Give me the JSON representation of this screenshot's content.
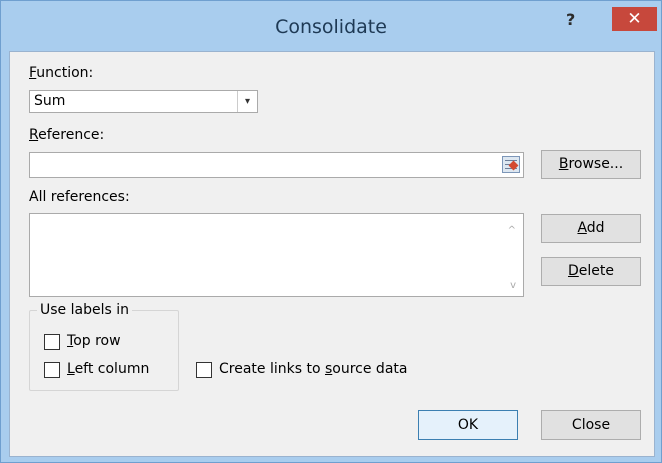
{
  "dialog": {
    "title": "Consolidate",
    "help_glyph": "?",
    "close_glyph": "✕"
  },
  "function": {
    "label_access": "F",
    "label_rest": "unction:",
    "selected": "Sum",
    "arrow_glyph": "▾"
  },
  "reference": {
    "label_access": "R",
    "label_rest": "eference:",
    "value": ""
  },
  "browse": {
    "access": "B",
    "rest": "rowse..."
  },
  "all_references": {
    "label": "All references:",
    "scroll_up": "^",
    "scroll_down": "v"
  },
  "add": {
    "access": "A",
    "rest": "dd"
  },
  "delete": {
    "access": "D",
    "rest": "elete"
  },
  "labels_group": {
    "legend": "Use labels in",
    "top_row": {
      "access": "T",
      "rest": "op row",
      "checked": false
    },
    "left_column": {
      "access": "L",
      "rest": "eft column",
      "checked": false
    }
  },
  "links": {
    "before": "Create links to ",
    "access": "s",
    "after": "ource data",
    "checked": false
  },
  "ok_label": "OK",
  "close_label": "Close",
  "colors": {
    "title_bar": "#a9cdee",
    "close_button": "#c7483c",
    "client": "#f0f0f0"
  }
}
